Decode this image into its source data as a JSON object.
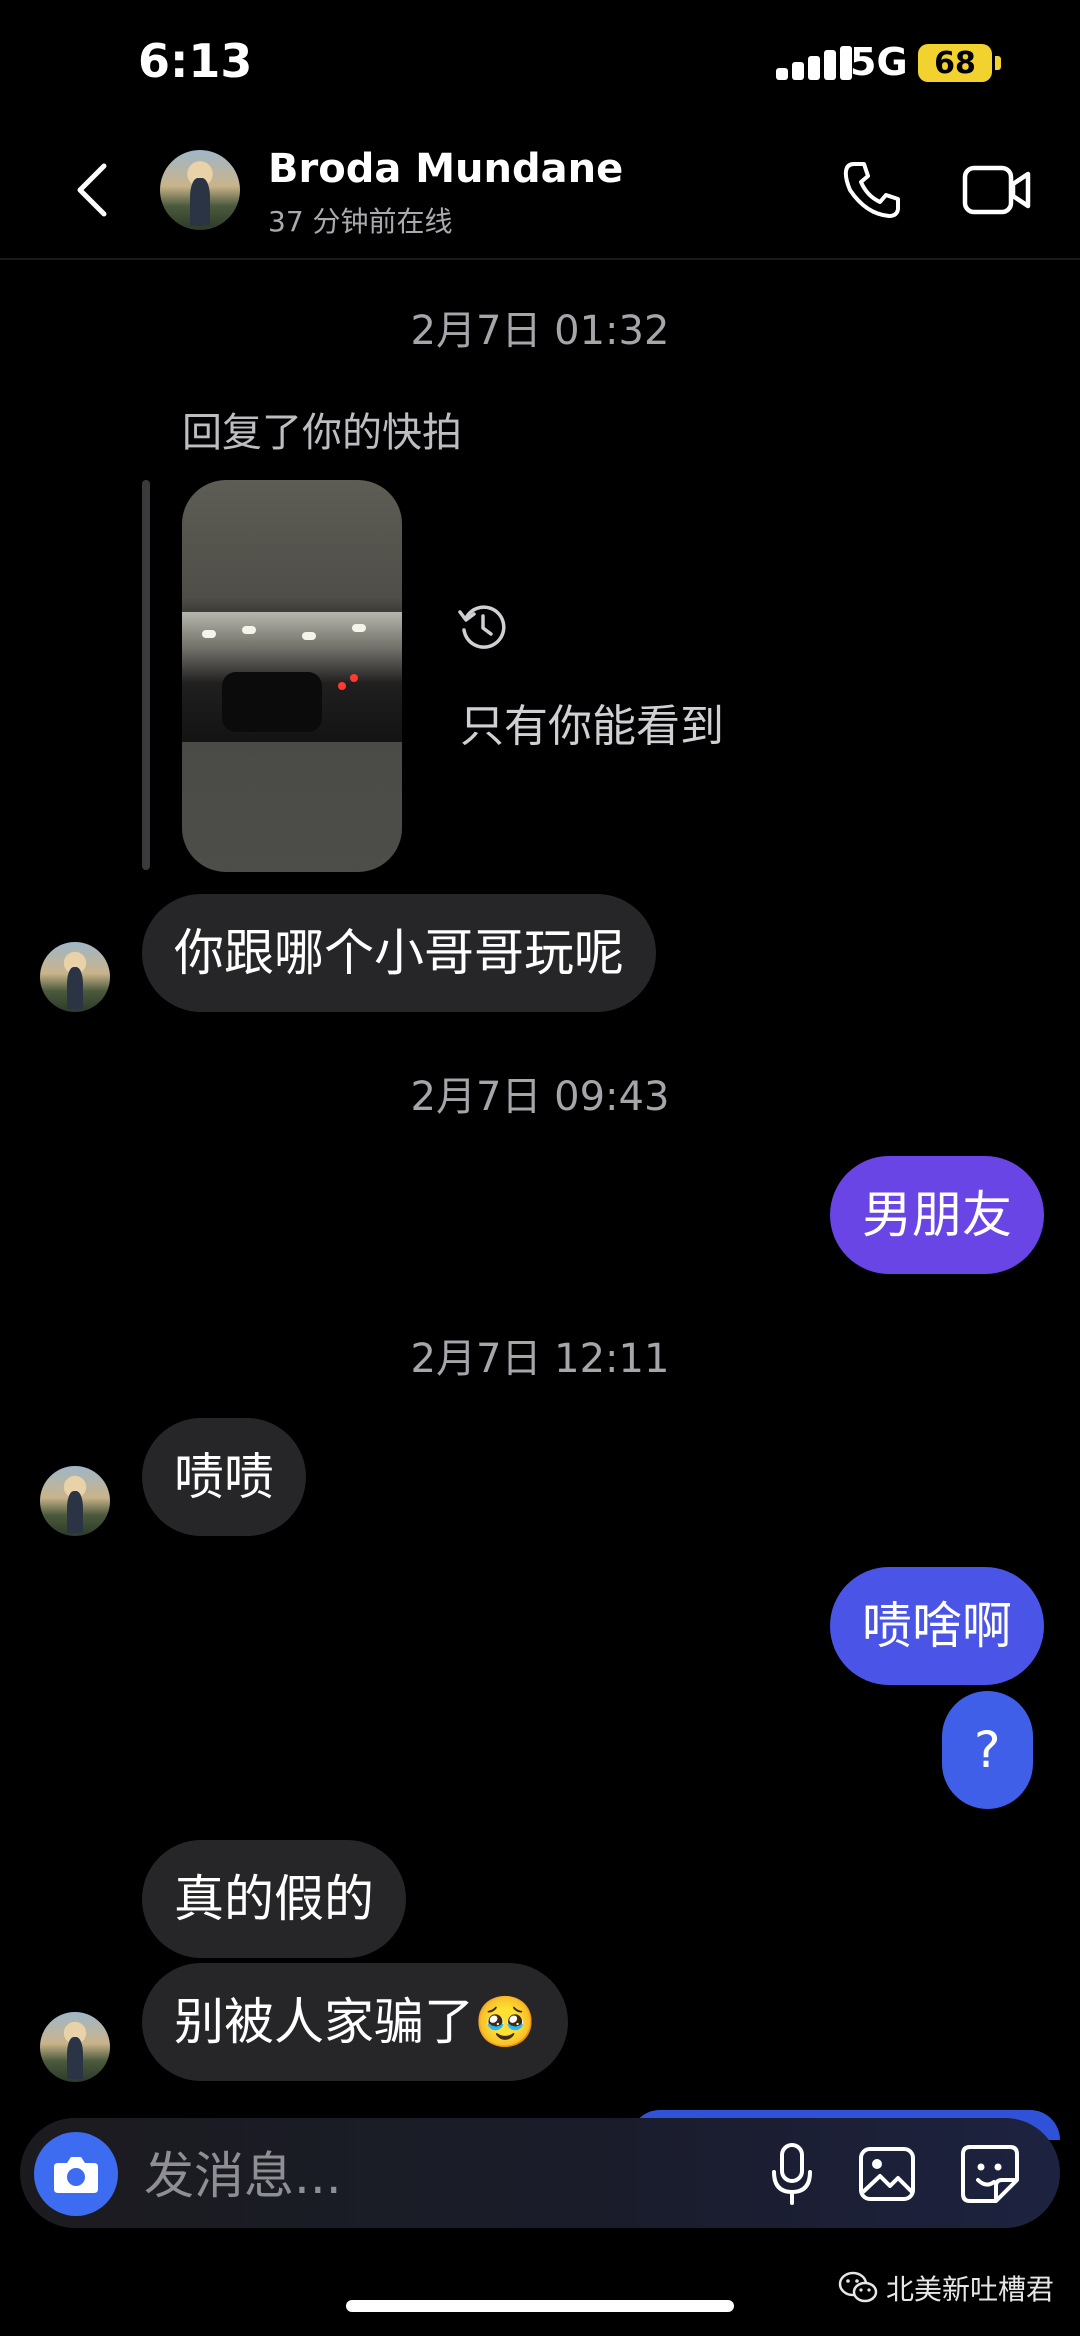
{
  "status_bar": {
    "time": "6:13",
    "network": "5G",
    "battery": "68"
  },
  "header": {
    "name": "Broda Mundane",
    "status": "37 分钟前在线"
  },
  "timestamps": {
    "t1": "2月7日 01:32",
    "t2": "2月7日 09:43",
    "t3": "2月7日 12:11"
  },
  "story_reply": {
    "label": "回复了你的快拍",
    "visibility": "只有你能看到"
  },
  "messages": {
    "m1": "你跟哪个小哥哥玩呢",
    "m2": "男朋友",
    "m3": "啧啧",
    "m4": "啧啥啊",
    "m5": "?",
    "m6": "真的假的",
    "m7": "别被人家骗了🥹"
  },
  "composer": {
    "placeholder": "发消息..."
  },
  "watermark": "北美新吐槽君",
  "colors": {
    "incoming": "#262628",
    "outgoing_purple": "#6a45e6",
    "outgoing_blue": "#3f5fe8",
    "accent": "#3d6cf0"
  }
}
